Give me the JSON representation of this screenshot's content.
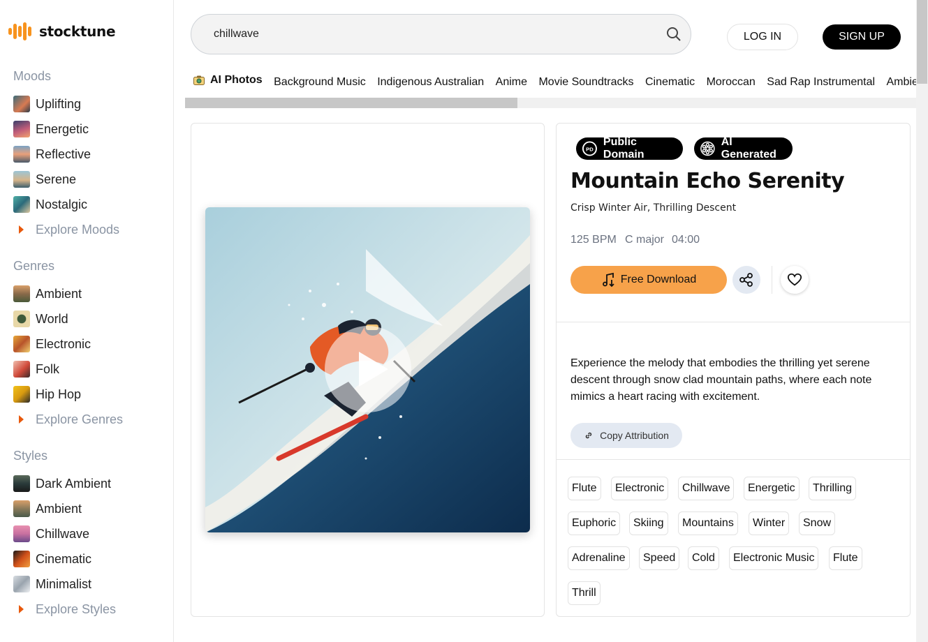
{
  "brand": {
    "name": "stocktune",
    "color": "#f7931e"
  },
  "search": {
    "value": "chillwave"
  },
  "auth": {
    "login": "LOG IN",
    "signup": "SIGN UP"
  },
  "sidebar": {
    "moods": {
      "title": "Moods",
      "items": [
        {
          "label": "Uplifting"
        },
        {
          "label": "Energetic"
        },
        {
          "label": "Reflective"
        },
        {
          "label": "Serene"
        },
        {
          "label": "Nostalgic"
        }
      ],
      "explore": "Explore Moods"
    },
    "genres": {
      "title": "Genres",
      "items": [
        {
          "label": "Ambient"
        },
        {
          "label": "World"
        },
        {
          "label": "Electronic"
        },
        {
          "label": "Folk"
        },
        {
          "label": "Hip Hop"
        }
      ],
      "explore": "Explore Genres"
    },
    "styles": {
      "title": "Styles",
      "items": [
        {
          "label": "Dark Ambient"
        },
        {
          "label": "Ambient"
        },
        {
          "label": "Chillwave"
        },
        {
          "label": "Cinematic"
        },
        {
          "label": "Minimalist"
        }
      ],
      "explore": "Explore Styles"
    }
  },
  "chips": {
    "ai_photos": "AI Photos",
    "items": [
      "Background Music",
      "Indigenous Australian",
      "Anime",
      "Movie Soundtracks",
      "Cinematic",
      "Moroccan",
      "Sad Rap Instrumental",
      "Ambient"
    ]
  },
  "track": {
    "badge_public_domain": "Public Domain",
    "badge_ai_generated": "AI Generated",
    "title": "Mountain Echo Serenity",
    "subtitle": "Crisp Winter Air, Thrilling Descent",
    "bpm": "125 BPM",
    "key": "C major",
    "duration": "04:00",
    "download_label": "Free Download",
    "description": "Experience the melody that embodies the thrilling yet serene descent through snow clad mountain paths, where each note mimics a heart racing with excitement.",
    "copy_attribution": "Copy Attribution",
    "tags": [
      "Flute",
      "Electronic",
      "Chillwave",
      "Energetic",
      "Thrilling",
      "Euphoric",
      "Skiing",
      "Mountains",
      "Winter",
      "Snow",
      "Adrenaline",
      "Speed",
      "Cold",
      "Electronic Music",
      "Flute",
      "Thrill"
    ]
  }
}
